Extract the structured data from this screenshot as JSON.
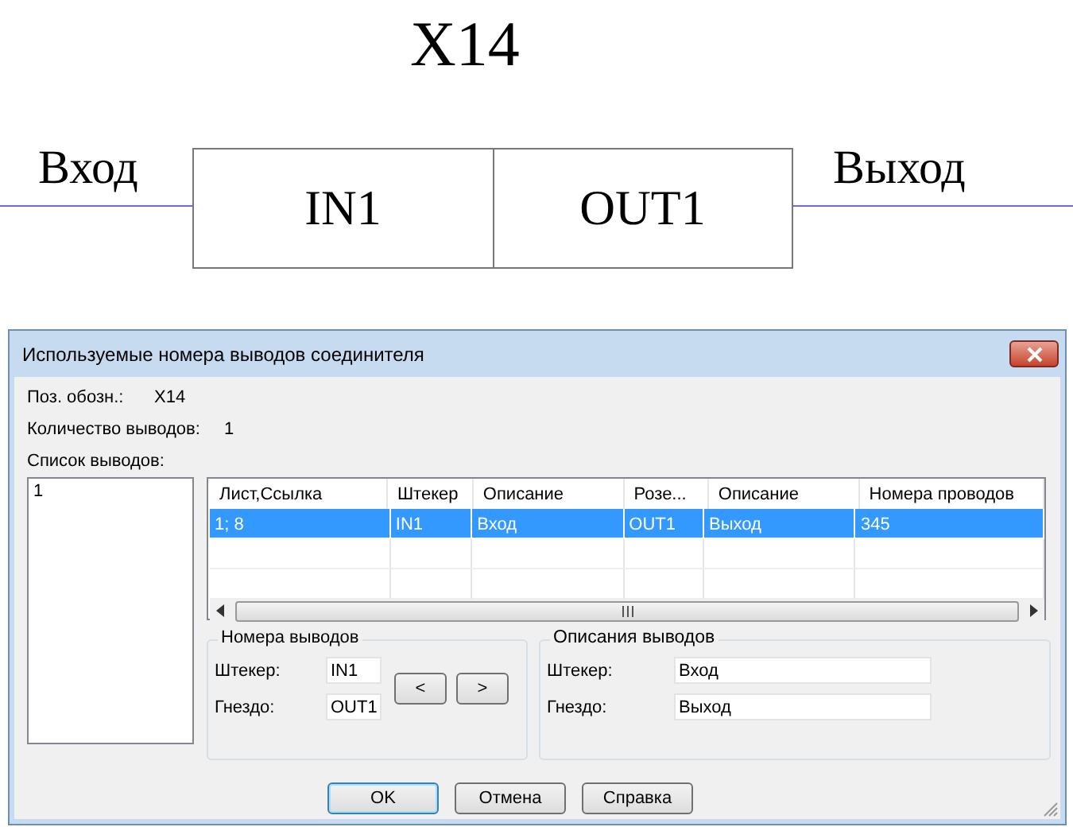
{
  "schematic": {
    "title": "X14",
    "input_label": "Вход",
    "output_label": "Выход",
    "pins": [
      "IN1",
      "OUT1"
    ]
  },
  "dialog": {
    "title": "Используемые номера выводов соединителя",
    "fields": [
      {
        "label": "Поз. обозн.:",
        "value": "X14"
      },
      {
        "label": "Количество выводов:",
        "value": "1"
      }
    ],
    "list_label": "Список выводов:",
    "list_items": [
      {
        "text": "1",
        "selected": false
      }
    ],
    "table": {
      "columns": [
        "Лист,Ссылка",
        "Штекер",
        "Описание",
        "Розе...",
        "Описание",
        "Номера проводов"
      ],
      "rows": [
        {
          "cells": [
            "1; 8",
            "IN1",
            "Вход",
            "OUT1",
            "Выход",
            "345"
          ],
          "selected": true
        }
      ]
    },
    "pin_numbers": {
      "title": "Номера выводов",
      "fields": [
        {
          "label": "Штекер:",
          "value": "IN1"
        },
        {
          "label": "Гнездо:",
          "value": "OUT1"
        }
      ]
    },
    "nav_buttons": [
      "<",
      ">"
    ],
    "pin_descriptions": {
      "title": "Описания выводов",
      "fields": [
        {
          "label": "Штекер:",
          "value": "Вход"
        },
        {
          "label": "Гнездо:",
          "value": "Выход"
        }
      ]
    },
    "buttons": [
      {
        "label": "OK",
        "kind": "default"
      },
      {
        "label": "Отмена",
        "kind": "normal"
      },
      {
        "label": "Справка",
        "kind": "normal"
      }
    ]
  }
}
